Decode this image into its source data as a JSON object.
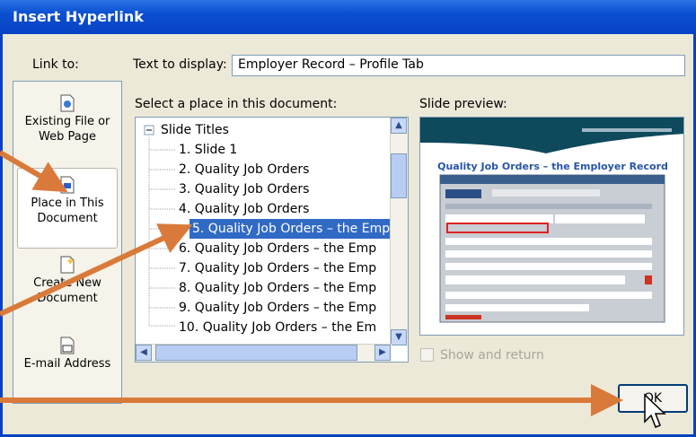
{
  "window": {
    "title": "Insert Hyperlink"
  },
  "link_to": {
    "label": "Link to:",
    "items": [
      {
        "label": "Existing File or Web Page",
        "icon": "existing-file-icon"
      },
      {
        "label": "Place in This Document",
        "icon": "place-in-document-icon",
        "selected": true
      },
      {
        "label": "Create New Document",
        "icon": "new-document-icon"
      },
      {
        "label": "E-mail Address",
        "icon": "email-icon"
      }
    ]
  },
  "text_to_display": {
    "label": "Text to display:",
    "value": "Employer Record – Profile Tab"
  },
  "place": {
    "label": "Select a place in this document:",
    "root": "Slide Titles",
    "items": [
      "1. Slide 1",
      "2. Quality Job Orders",
      "3. Quality Job Orders",
      "4. Quality Job Orders",
      "5. Quality Job Orders – the Emp",
      "6. Quality Job Orders – the Emp",
      "7. Quality Job Orders – the Emp",
      "8. Quality Job Orders – the Emp",
      "9. Quality Job Orders – the Emp",
      "10. Quality Job Orders – the Em"
    ],
    "selected_index": 4
  },
  "preview": {
    "label": "Slide preview:",
    "slide_title": "Quality Job Orders – the Employer Record"
  },
  "show_and_return": {
    "label": "Show and return",
    "checked": false,
    "enabled": false
  },
  "buttons": {
    "ok": "OK"
  },
  "colors": {
    "title_bar": "#0842c4",
    "selection": "#316ac5",
    "arrow": "#d97a3a",
    "preview_title": "#2855a8"
  }
}
